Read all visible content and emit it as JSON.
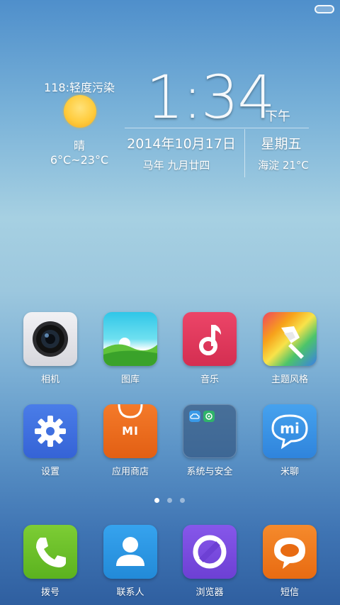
{
  "status_bar": {
    "icon": "battery-pill-icon"
  },
  "weather": {
    "aqi": "118:轻度污染",
    "condition": "晴",
    "temp_range": "6°C~23°C",
    "icon": "sun-icon"
  },
  "clock": {
    "time": "1:34",
    "ampm": "下午",
    "date": "2014年10月17日",
    "lunar": "马年 九月廿四",
    "weekday": "星期五",
    "city_temp": "海淀 21°C"
  },
  "apps_row1": [
    {
      "label": "相机",
      "icon": "camera-icon"
    },
    {
      "label": "图库",
      "icon": "gallery-icon"
    },
    {
      "label": "音乐",
      "icon": "music-icon"
    },
    {
      "label": "主题风格",
      "icon": "theme-brush-icon"
    }
  ],
  "apps_row2": [
    {
      "label": "设置",
      "icon": "gear-icon"
    },
    {
      "label": "应用商店",
      "icon": "mi-store-icon",
      "badge": "MI"
    },
    {
      "label": "系统与安全",
      "icon": "folder-icon"
    },
    {
      "label": "米聊",
      "icon": "mitalk-icon",
      "badge": "mi"
    }
  ],
  "dock": [
    {
      "label": "拨号",
      "icon": "phone-icon"
    },
    {
      "label": "联系人",
      "icon": "contacts-icon"
    },
    {
      "label": "浏览器",
      "icon": "browser-icon"
    },
    {
      "label": "短信",
      "icon": "sms-icon"
    }
  ],
  "pager": {
    "pages": 3,
    "current": 1
  },
  "colors": {
    "camera": "#e8e8ec",
    "music": "#e0365c",
    "settings": "#3f6fe0",
    "store": "#ec6b1f",
    "mitalk": "#3b93e6",
    "dialer": "#6dc22a",
    "contacts": "#2c97e6",
    "browser": "#7a4fe0",
    "sms": "#f07a1d"
  }
}
